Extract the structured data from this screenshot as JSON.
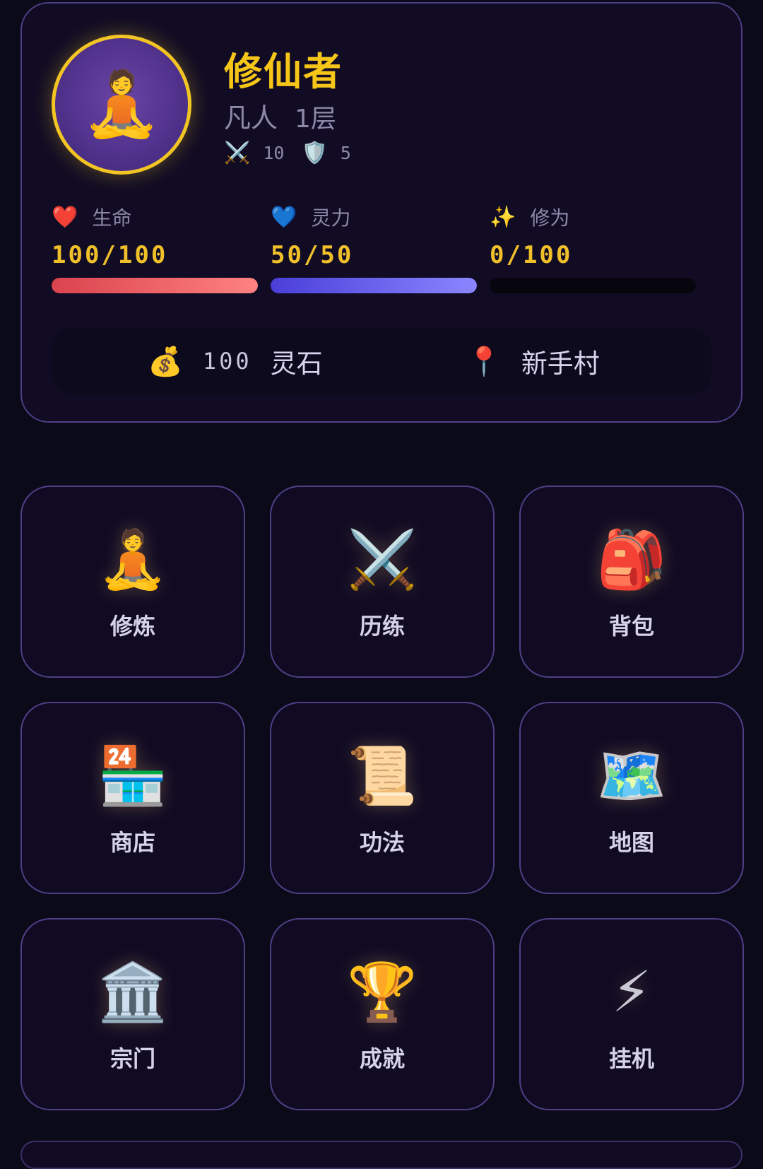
{
  "player": {
    "name": "修仙者",
    "realm": "凡人",
    "level": "1层",
    "avatar_icon": "🧘",
    "attack_icon": "⚔️",
    "attack": "10",
    "defense_icon": "🛡️",
    "defense": "5"
  },
  "stats": {
    "hp": {
      "icon": "❤️",
      "label": "生命",
      "value": "100/100",
      "current": 100,
      "max": 100,
      "color_from": "#d9434d",
      "color_to": "#ff8282"
    },
    "mp": {
      "icon": "💙",
      "label": "灵力",
      "value": "50/50",
      "current": 50,
      "max": 50,
      "color_from": "#4a3ed8",
      "color_to": "#8b86ff"
    },
    "exp": {
      "icon": "✨",
      "label": "修为",
      "value": "0/100",
      "current": 0,
      "max": 100,
      "color_from": "#f0c02a",
      "color_to": "#ffd966"
    }
  },
  "resources": {
    "stones_icon": "💰",
    "stones_amount": "100",
    "stones_label": "灵石",
    "location_icon": "📍",
    "location": "新手村"
  },
  "menu": [
    {
      "id": "cultivate",
      "icon": "🧘",
      "label": "修炼"
    },
    {
      "id": "adventure",
      "icon": "⚔️",
      "label": "历练"
    },
    {
      "id": "bag",
      "icon": "🎒",
      "label": "背包"
    },
    {
      "id": "shop",
      "icon": "🏪",
      "label": "商店"
    },
    {
      "id": "skills",
      "icon": "📜",
      "label": "功法"
    },
    {
      "id": "map",
      "icon": "🗺️",
      "label": "地图"
    },
    {
      "id": "sect",
      "icon": "🏛️",
      "label": "宗门"
    },
    {
      "id": "achievements",
      "icon": "🏆",
      "label": "成就"
    },
    {
      "id": "idle",
      "icon": "⚡",
      "label": "挂机"
    }
  ]
}
